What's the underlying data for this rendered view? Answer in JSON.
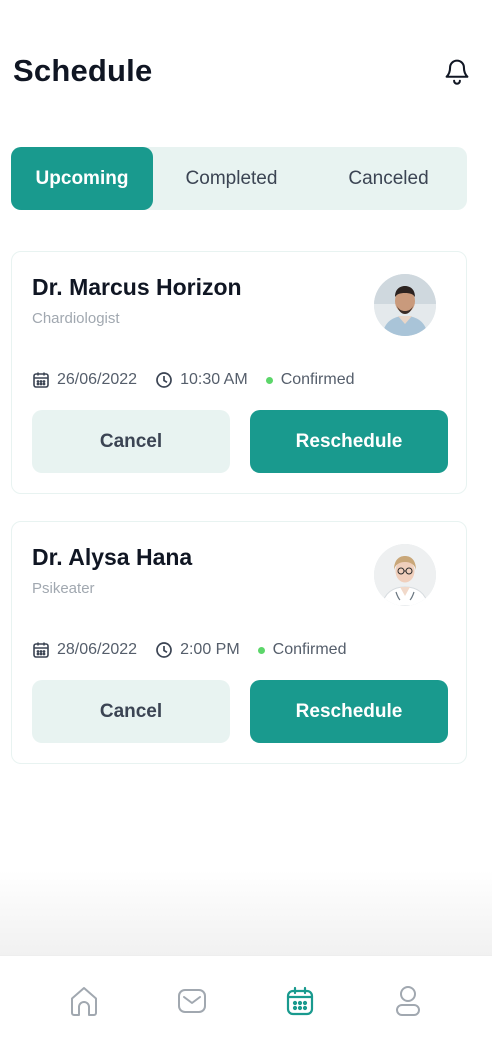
{
  "header": {
    "title": "Schedule"
  },
  "tabs": [
    {
      "label": "Upcoming",
      "active": true
    },
    {
      "label": "Completed",
      "active": false
    },
    {
      "label": "Canceled",
      "active": false
    }
  ],
  "appointments": [
    {
      "doctor": "Dr. Marcus Horizon",
      "specialty": "Chardiologist",
      "date": "26/06/2022",
      "time": "10:30 AM",
      "status": "Confirmed",
      "cancel_label": "Cancel",
      "reschedule_label": "Reschedule"
    },
    {
      "doctor": "Dr. Alysa Hana",
      "specialty": "Psikeater",
      "date": "28/06/2022",
      "time": "2:00 PM",
      "status": "Confirmed",
      "cancel_label": "Cancel",
      "reschedule_label": "Reschedule"
    }
  ],
  "bottom_nav": [
    {
      "icon": "home-icon",
      "active": false
    },
    {
      "icon": "message-icon",
      "active": false
    },
    {
      "icon": "calendar-icon",
      "active": true
    },
    {
      "icon": "profile-icon",
      "active": false
    }
  ],
  "colors": {
    "accent": "#199a8e",
    "accent_light": "#e8f3f1",
    "status_green": "#5cd66a",
    "text_dark": "#101623",
    "text_muted": "#a1a8b0"
  }
}
